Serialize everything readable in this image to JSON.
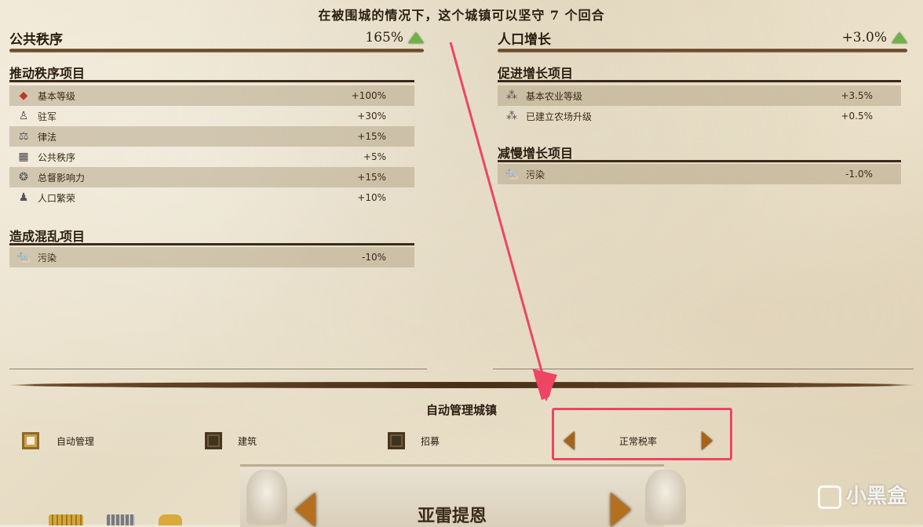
{
  "siege_text": "在被围城的情况下，这个城镇可以坚守 7 个回合",
  "left": {
    "stat_title": "公共秩序",
    "stat_value": "165%",
    "sections": [
      {
        "title": "推动秩序项目",
        "rows": [
          {
            "icon": "level-icon",
            "glyph": "◆",
            "color": "#c0392b",
            "label": "基本等级",
            "value": "+100%"
          },
          {
            "icon": "garrison-icon",
            "glyph": "♙",
            "color": "#444",
            "label": "驻军",
            "value": "+30%"
          },
          {
            "icon": "law-scales-icon",
            "glyph": "⚖",
            "color": "#555",
            "label": "律法",
            "value": "+15%"
          },
          {
            "icon": "public-order-icon",
            "glyph": "▦",
            "color": "#444",
            "label": "公共秩序",
            "value": "+5%"
          },
          {
            "icon": "governor-influence-icon",
            "glyph": "❂",
            "color": "#555",
            "label": "总督影响力",
            "value": "+15%"
          },
          {
            "icon": "population-icon",
            "glyph": "♟",
            "color": "#555",
            "label": "人口繁荣",
            "value": "+10%"
          }
        ]
      },
      {
        "title": "造成混乱项目",
        "rows": [
          {
            "icon": "pollution-rat-icon",
            "glyph": "🐀",
            "color": "#b03a1a",
            "label": "污染",
            "value": "-10%"
          }
        ]
      }
    ]
  },
  "right": {
    "stat_title": "人口增长",
    "stat_value": "+3.0%",
    "sections": [
      {
        "title": "促进增长项目",
        "rows": [
          {
            "icon": "farming-grain-icon",
            "glyph": "⁂",
            "color": "#555",
            "label": "基本农业等级",
            "value": "+3.5%"
          },
          {
            "icon": "farm-upgrade-grain-icon",
            "glyph": "⁂",
            "color": "#555",
            "label": "已建立农场升级",
            "value": "+0.5%"
          }
        ]
      },
      {
        "title": "减慢增长项目",
        "rows": [
          {
            "icon": "pollution-rat-icon",
            "glyph": "🐀",
            "color": "#b03a1a",
            "label": "污染",
            "value": "-1.0%"
          }
        ]
      }
    ]
  },
  "auto_manage": {
    "title": "自动管理城镇",
    "options": [
      {
        "label": "自动管理",
        "checked": true
      },
      {
        "label": "建筑",
        "checked": false
      },
      {
        "label": "招募",
        "checked": false
      }
    ],
    "tax_rate": "正常税率"
  },
  "city_name": "亚雷提恩",
  "watermark": "小黑盒",
  "colors": {
    "highlight": "#ee4466",
    "arrow": "#a5641c",
    "up_indicator": "#6fb14a"
  }
}
